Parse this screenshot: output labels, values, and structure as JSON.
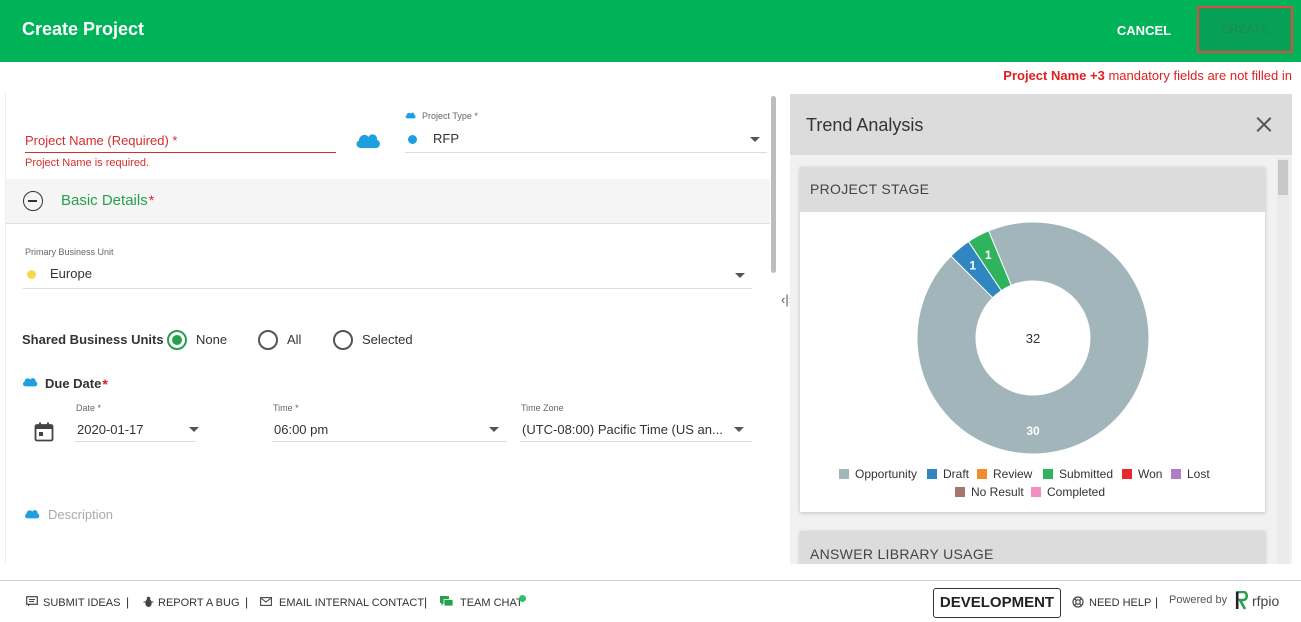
{
  "header": {
    "title": "Create Project",
    "cancel_label": "CANCEL",
    "create_label": "CREATE"
  },
  "validation": {
    "field_name": "Project Name",
    "extra_count": "+3",
    "message": "mandatory fields are not filled in"
  },
  "form": {
    "project_name": {
      "placeholder": "Project Name (Required) *",
      "error": "Project Name is required."
    },
    "project_type": {
      "label": "Project Type *",
      "value": "RFP",
      "dot_color": "#1ea0e0"
    },
    "basic_details": {
      "title": "Basic Details",
      "star": "*"
    },
    "primary_business_unit": {
      "label": "Primary Business Unit",
      "value": "Europe",
      "dot_color": "#f5d94a"
    },
    "shared_business_units": {
      "label": "Shared Business Units",
      "options": [
        "None",
        "All",
        "Selected"
      ],
      "selected": "None"
    },
    "due_date": {
      "title": "Due Date",
      "star": "*",
      "date_label": "Date *",
      "date_value": "2020-01-17",
      "time_label": "Time *",
      "time_value": "06:00 pm",
      "timezone_label": "Time Zone",
      "timezone_value": "(UTC-08:00) Pacific Time (US an..."
    },
    "description": {
      "label": "Description"
    }
  },
  "trend": {
    "title": "Trend Analysis",
    "card_title": "PROJECT STAGE",
    "center_total": "32",
    "card2_title": "ANSWER LIBRARY USAGE"
  },
  "chart_data": {
    "type": "pie",
    "title": "PROJECT STAGE",
    "categories": [
      "Opportunity",
      "Draft",
      "Review",
      "Submitted",
      "Won",
      "Lost",
      "No Result",
      "Completed"
    ],
    "values": [
      30,
      1,
      0,
      1,
      0,
      0,
      0,
      0
    ],
    "colors": [
      "#a1b5ba",
      "#2f86c1",
      "#f28c28",
      "#2fb35d",
      "#e8272d",
      "#b07cc6",
      "#a8766c",
      "#f48ec2"
    ],
    "legend_placement": "bottom"
  },
  "footer": {
    "submit_ideas": "SUBMIT IDEAS",
    "report_bug": "REPORT A BUG",
    "email_contact": "EMAIL INTERNAL CONTACT",
    "team_chat": "TEAM CHAT",
    "environment": "DEVELOPMENT",
    "need_help": "NEED HELP",
    "powered_by": "Powered by",
    "brand": "rfpio"
  },
  "colors": {
    "brand_green": "#00b359",
    "error_red": "#d32f2f",
    "cloud_blue": "#1ea0e0"
  }
}
